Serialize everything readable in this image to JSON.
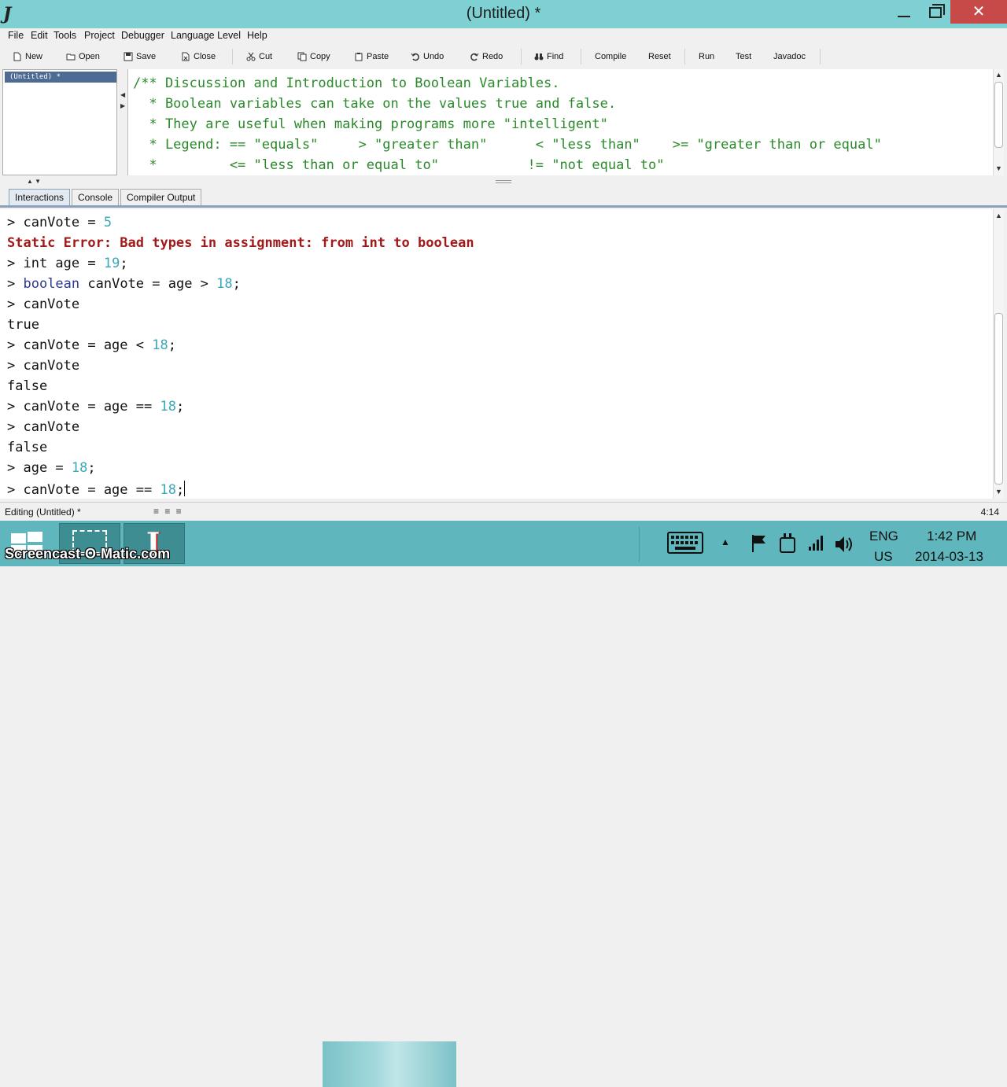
{
  "window": {
    "title": "(Untitled) *",
    "app_logo": "J"
  },
  "menu": [
    "File",
    "Edit",
    "Tools",
    "Project",
    "Debugger",
    "Language Level",
    "Help"
  ],
  "toolbar": {
    "new": "New",
    "open": "Open",
    "save": "Save",
    "close": "Close",
    "cut": "Cut",
    "copy": "Copy",
    "paste": "Paste",
    "undo": "Undo",
    "redo": "Redo",
    "find": "Find",
    "compile": "Compile",
    "reset": "Reset",
    "run": "Run",
    "test": "Test",
    "javadoc": "Javadoc"
  },
  "doclist": {
    "items": [
      "(Untitled) *"
    ]
  },
  "editor": {
    "lines": [
      "/** Discussion and Introduction to Boolean Variables.",
      "  * Boolean variables can take on the values true and false.",
      "  * They are useful when making programs more \"intelligent\"",
      "  * Legend: == \"equals\"     > \"greater than\"      < \"less than\"    >= \"greater than or equal\"",
      "  *         <= \"less than or equal to\"           != \"not equal to\""
    ]
  },
  "tabs": [
    "Interactions",
    "Console",
    "Compiler Output"
  ],
  "interactions": {
    "l1": {
      "pre": "> canVote = ",
      "num": "5",
      "post": ""
    },
    "error": "Static Error: Bad types in assignment: from int to boolean",
    "l3": {
      "pre": "> int age = ",
      "num": "19",
      "post": ";"
    },
    "l4": {
      "pre": "> ",
      "kw": "boolean",
      "mid": " canVote = age > ",
      "num": "18",
      "post": ";"
    },
    "l5": "> canVote",
    "l6": "true",
    "l7": {
      "pre": "> canVote = age < ",
      "num": "18",
      "post": ";"
    },
    "l8": "> canVote",
    "l9": "false",
    "l10": {
      "pre": "> canVote = age == ",
      "num": "18",
      "post": ";"
    },
    "l11": "> canVote",
    "l12": "false",
    "l13": {
      "pre": "> age = ",
      "num": "18",
      "post": ";"
    },
    "l14": {
      "pre": "> canVote = age == ",
      "num": "18",
      "post": ";"
    }
  },
  "status": {
    "text": "Editing (Untitled) *",
    "position": "4:14"
  },
  "taskbar": {
    "watermark": "Screencast-O-Matic.com",
    "lang_top": "ENG",
    "lang_bottom": "US",
    "time": "1:42 PM",
    "date": "2014-03-13"
  },
  "colors": {
    "titlebar": "#7fd0d3",
    "taskbar": "#5fb6bd",
    "comment": "#2a8a2a",
    "number": "#3aa8b8",
    "error": "#a11a1a",
    "close": "#c74a49"
  }
}
